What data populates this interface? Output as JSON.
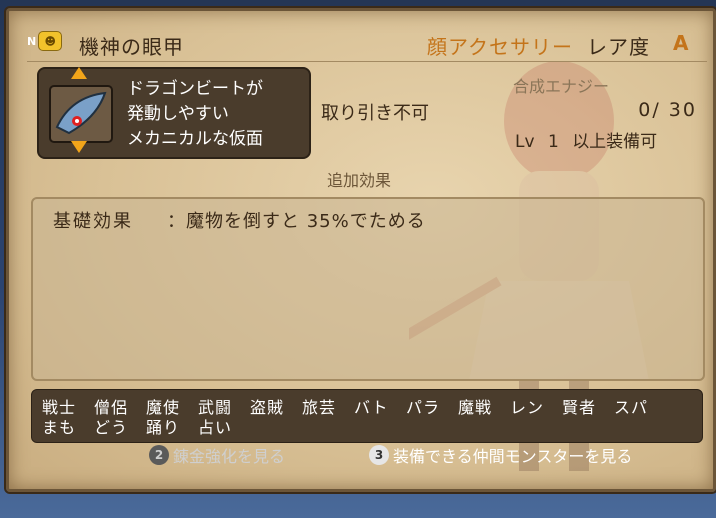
{
  "item": {
    "name": "機神の眼甲",
    "new_badge": "N",
    "type": "顔アクセサリー",
    "rarity_label": "レア度",
    "rarity_value": "A",
    "description": [
      "ドラゴンビートが",
      "発動しやすい",
      "メカニカルな仮面"
    ],
    "trade": "取り引き不可",
    "synth_label": "合成エナジー",
    "synth_value": "0/ 30",
    "lv_label": "Lv",
    "lv_value": "1",
    "lv_suffix": "以上装備可"
  },
  "effects": {
    "title": "追加効果",
    "base_label": "基礎効果",
    "base_text": "：魔物を倒すと 35%でためる"
  },
  "jobs": {
    "row1": [
      "戦士",
      "僧侶",
      "魔使",
      "武闘",
      "盗賊",
      "旅芸",
      "バト",
      "パラ",
      "魔戦",
      "レン",
      "賢者",
      "スパ"
    ],
    "row2": [
      "まも",
      "どう",
      "踊り",
      "占い"
    ]
  },
  "footer": {
    "btn2_num": "2",
    "btn2_label": "錬金強化を見る",
    "btn3_num": "3",
    "btn3_label": "装備できる仲間モンスターを見る"
  },
  "colors": {
    "accent": "#c4741a",
    "text_dark": "#3b2a18",
    "panel_dark": "#4a3c2c"
  }
}
